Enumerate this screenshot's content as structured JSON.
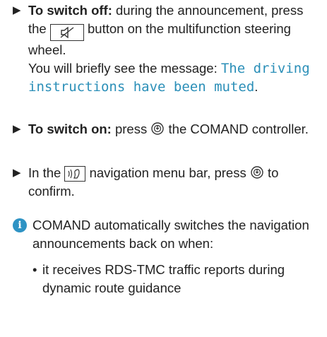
{
  "steps": [
    {
      "bold": "To switch off:",
      "text_before_key": " during the announcement, press the ",
      "key_icon": "mute-speaker-icon",
      "text_after_key": " button on the multifunction steering wheel.",
      "message_intro": "You will briefly see the message: ",
      "message": "The driving instructions have been muted",
      "message_end": "."
    },
    {
      "bold": "To switch on:",
      "text_before_icon": " press ",
      "controller_icon": "controller-press-icon",
      "text_after_icon": " the COMAND controller."
    },
    {
      "text_before_icon": "In the ",
      "menu_icon": "navigation-announcement-icon",
      "text_mid": " navigation menu bar, press ",
      "controller_icon": "controller-press-icon",
      "text_after_icon": " to confirm."
    }
  ],
  "note": {
    "icon": "info-icon",
    "icon_glyph": "i",
    "text": "COMAND automatically switches the navigation announcements back on when:",
    "bullets": [
      "it receives RDS-TMC traffic reports during dynamic route guidance"
    ]
  },
  "colors": {
    "message": "#2b8fb8",
    "info_icon": "#2e93c4"
  }
}
